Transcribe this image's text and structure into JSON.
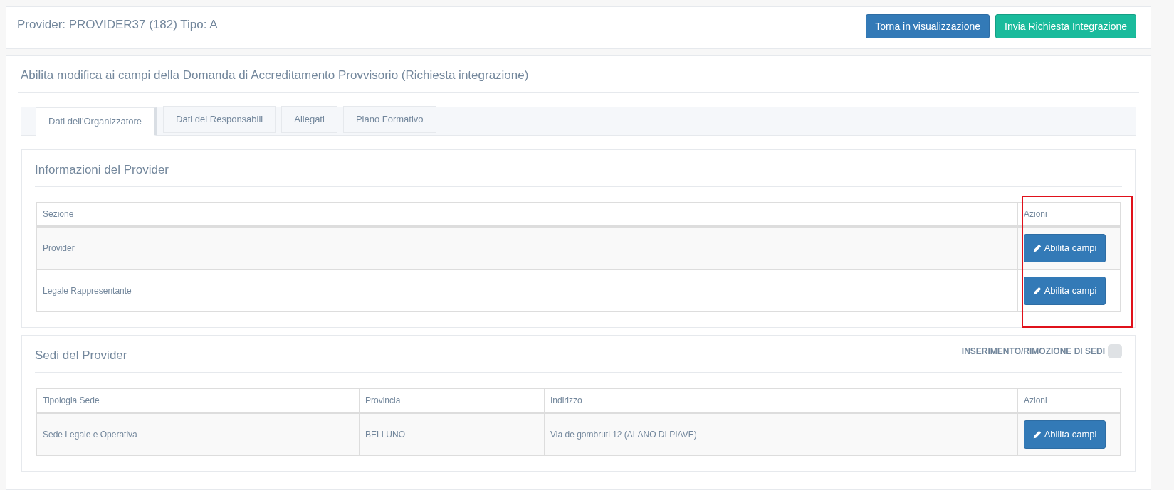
{
  "header": {
    "title": "Provider: PROVIDER37 (182) Tipo: A",
    "buttons": [
      {
        "label": "Torna in visualizzazione",
        "kind": "primary"
      },
      {
        "label": "Invia Richiesta Integrazione",
        "kind": "success"
      }
    ]
  },
  "main": {
    "title": "Abilita modifica ai campi della Domanda di Accreditamento Provvisorio (Richiesta integrazione)",
    "tabs": [
      {
        "label": "Dati dell'Organizzatore",
        "selected": true
      },
      {
        "label": "Dati dei Responsabili",
        "selected": false
      },
      {
        "label": "Allegati",
        "selected": false
      },
      {
        "label": "Piano Formativo",
        "selected": false
      }
    ],
    "sections": [
      {
        "title": "Informazioni del Provider",
        "columns": [
          {
            "label": "Sezione",
            "highlighted": false
          },
          {
            "label": "Azioni",
            "highlighted": true
          }
        ],
        "rows": [
          {
            "cells": [
              "Provider"
            ],
            "action": "Abilita campi"
          },
          {
            "cells": [
              "Legale Rappresentante"
            ],
            "action": "Abilita campi"
          }
        ]
      },
      {
        "title": "Sedi del Provider",
        "toggle": {
          "label": "INSERIMENTO/RIMOZIONE DI SEDI",
          "on": false
        },
        "columns": [
          {
            "label": "Tipologia Sede",
            "highlighted": false
          },
          {
            "label": "Provincia",
            "highlighted": false
          },
          {
            "label": "Indirizzo",
            "highlighted": false
          },
          {
            "label": "Azioni",
            "highlighted": false
          }
        ],
        "rows": [
          {
            "cells": [
              "Sede Legale e Operativa",
              "BELLUNO",
              "Via de gombruti 12 (ALANO DI PIAVE)"
            ],
            "action": "Abilita campi"
          }
        ]
      }
    ]
  }
}
